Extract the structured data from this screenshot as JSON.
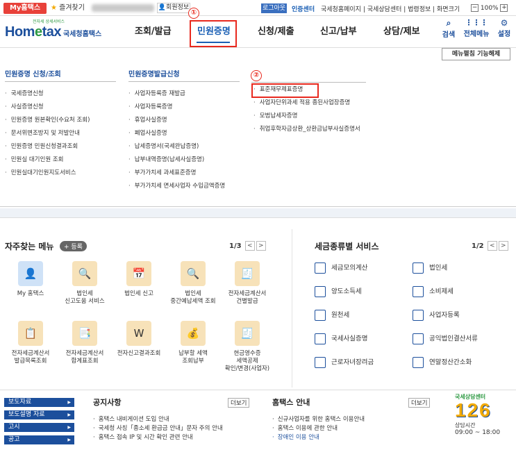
{
  "topbar": {
    "my_hometax": "My홈택스",
    "favorites": "즐겨찾기",
    "member_info": "회원정보",
    "logout": "로그아웃",
    "cert_center": "인증센터",
    "links": "국세청홈페이지 | 국세상담센터 | 법령정보 | 화면크기",
    "zoom": "100%"
  },
  "header": {
    "logo_brand_a": "Hom",
    "logo_brand_b": "e",
    "logo_brand_c": "tax",
    "logo_sub": "국세청홈택스",
    "logo_tag": "전자세 상세서비스",
    "nav": [
      "조회/발급",
      "민원증명",
      "신청/제출",
      "신고/납부",
      "상담/제보"
    ],
    "search": "검색",
    "all_menu": "전체메뉴",
    "settings": "설정",
    "marker1": "①",
    "marker2": "②"
  },
  "mega": {
    "unfix_btn": "메뉴펼침 기능해제",
    "col1": {
      "title": "민원증명 신청/조회",
      "items": [
        "국세증명신청",
        "사실증명신청",
        "민원증명 원본확인(수요처 조회)",
        "문서위변조방지 및 저발안내",
        "민원증명 민원신청결과조회",
        "민원실 대기인원 조회",
        "민원실대기인원지도서비스"
      ]
    },
    "col2": {
      "title": "민원증명발급신청",
      "items": [
        "사업자등록증 재발급",
        "사업자등록증명",
        "휴업사실증명",
        "폐업사실증명",
        "납세증명서(국세완납증명)",
        "납부내역증명(납세사실증명)",
        "부가가치세 과세표준증명",
        "부가가치세 면세사업자 수입금액증명"
      ]
    },
    "col3": {
      "items": [
        "표준재무제표증명",
        "사업자단위과세 적용 종된사업장증명",
        "모범납세자증명",
        "취업후학자금상환_상환금납부사실증명서"
      ]
    }
  },
  "quick": {
    "title": "자주찾는 메뉴",
    "register": "+ 등록",
    "page": "1/3",
    "items": [
      {
        "label": "My 홈택스",
        "icon": "person-icon"
      },
      {
        "label": "법인세\n신고도움 서비스",
        "icon": "doc-search-icon"
      },
      {
        "label": "법인세 신고",
        "icon": "calendar-icon"
      },
      {
        "label": "법인세\n중간예납세액 조회",
        "icon": "doc-search-icon"
      },
      {
        "label": "전자세금계산서\n건별발급",
        "icon": "invoice-icon"
      },
      {
        "label": "전자세금계산서\n발급목록조회",
        "icon": "list-search-icon"
      },
      {
        "label": "전자세금계산서\n합계표조회",
        "icon": "invoice-search-icon"
      },
      {
        "label": "전자신고결과조회",
        "icon": "w-search-icon"
      },
      {
        "label": "납부할 세액\n조회납부",
        "icon": "money-bag-icon"
      },
      {
        "label": "현금영수증\n세액공제\n확인/변경(사업자)",
        "icon": "receipt-icon"
      }
    ]
  },
  "services": {
    "title": "세금종류별 서비스",
    "page": "1/2",
    "items": [
      {
        "label": "세금모의계산",
        "icon": "calculator-icon"
      },
      {
        "label": "법인세",
        "icon": "building-icon"
      },
      {
        "label": "양도소득세",
        "icon": "transfer-icon"
      },
      {
        "label": "소비제세",
        "icon": "diamond-icon"
      },
      {
        "label": "원천세",
        "icon": "slip-icon"
      },
      {
        "label": "사업자등록",
        "icon": "user-icon"
      },
      {
        "label": "국세사실증명",
        "icon": "certificate-icon"
      },
      {
        "label": "공익법인결산서류",
        "icon": "checklist-icon"
      },
      {
        "label": "근로자녀장려금",
        "icon": "heart-hand-icon"
      },
      {
        "label": "연말정산간소화",
        "icon": "w-card-icon"
      }
    ]
  },
  "bottom": {
    "side": [
      "보도자료",
      "보도설명 자료",
      "고시",
      "공고"
    ],
    "notice_title": "공지사항",
    "notice_more": "더보기",
    "notice_items": [
      "홈택스 내비게이션 도입 안내",
      "국세청 사칭「종소세 환급금 안내」문자 주의 안내",
      "홈택스 접속 IP 및 시간 확인 관련 안내"
    ],
    "guide_title": "홈택스 안내",
    "guide_more": "더보기",
    "guide_items": [
      "신규사업자를 위한 홈택스 이용안내",
      "홈택스 이용에 관한 안내",
      "장애인 이용 안내"
    ],
    "center_label": "국세상담센터",
    "center_num": "126",
    "hours_label": "상담시간",
    "hours": "09:00 ~ 18:00"
  }
}
